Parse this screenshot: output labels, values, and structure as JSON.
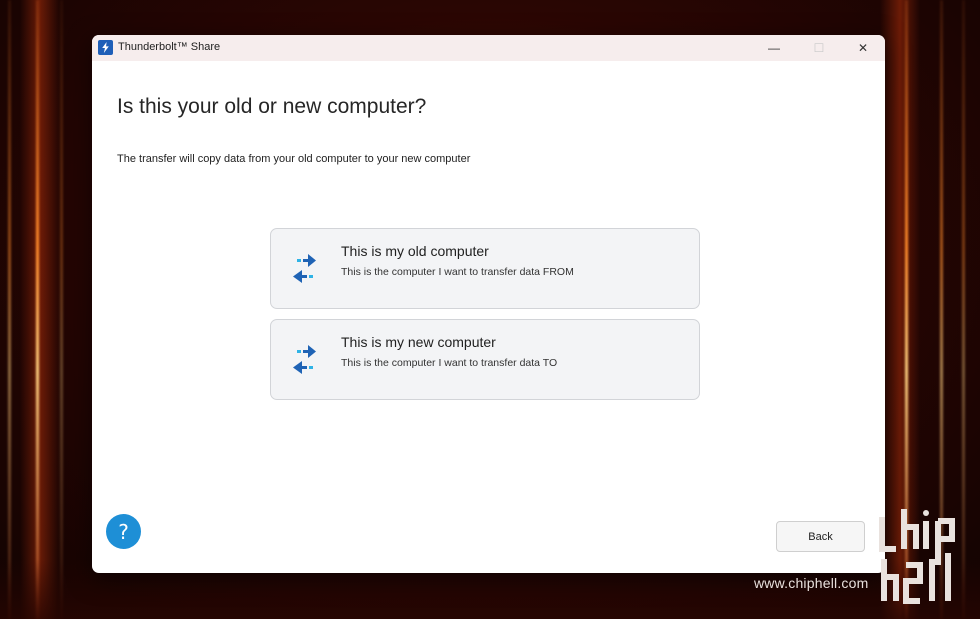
{
  "window": {
    "title": "Thunderbolt™ Share",
    "controls": {
      "minimize": "—",
      "maximize": "☐",
      "close": "✕"
    }
  },
  "page": {
    "title": "Is this your old or new computer?",
    "subtitle": "The transfer will copy data from your old computer to your new computer"
  },
  "options": [
    {
      "title": "This is my old computer",
      "description": "This is the computer I want to transfer data FROM",
      "icon": "transfer-arrows-icon"
    },
    {
      "title": "This is my new computer",
      "description": "This is the computer I want to transfer data TO",
      "icon": "transfer-arrows-icon"
    }
  ],
  "footer": {
    "help_label": "?",
    "back_label": "Back"
  },
  "watermark": {
    "text": "www.chiphell.com"
  },
  "colors": {
    "accent": "#1e8fd6",
    "icon_blue": "#1f63b5",
    "icon_cyan": "#2fb3e6"
  }
}
